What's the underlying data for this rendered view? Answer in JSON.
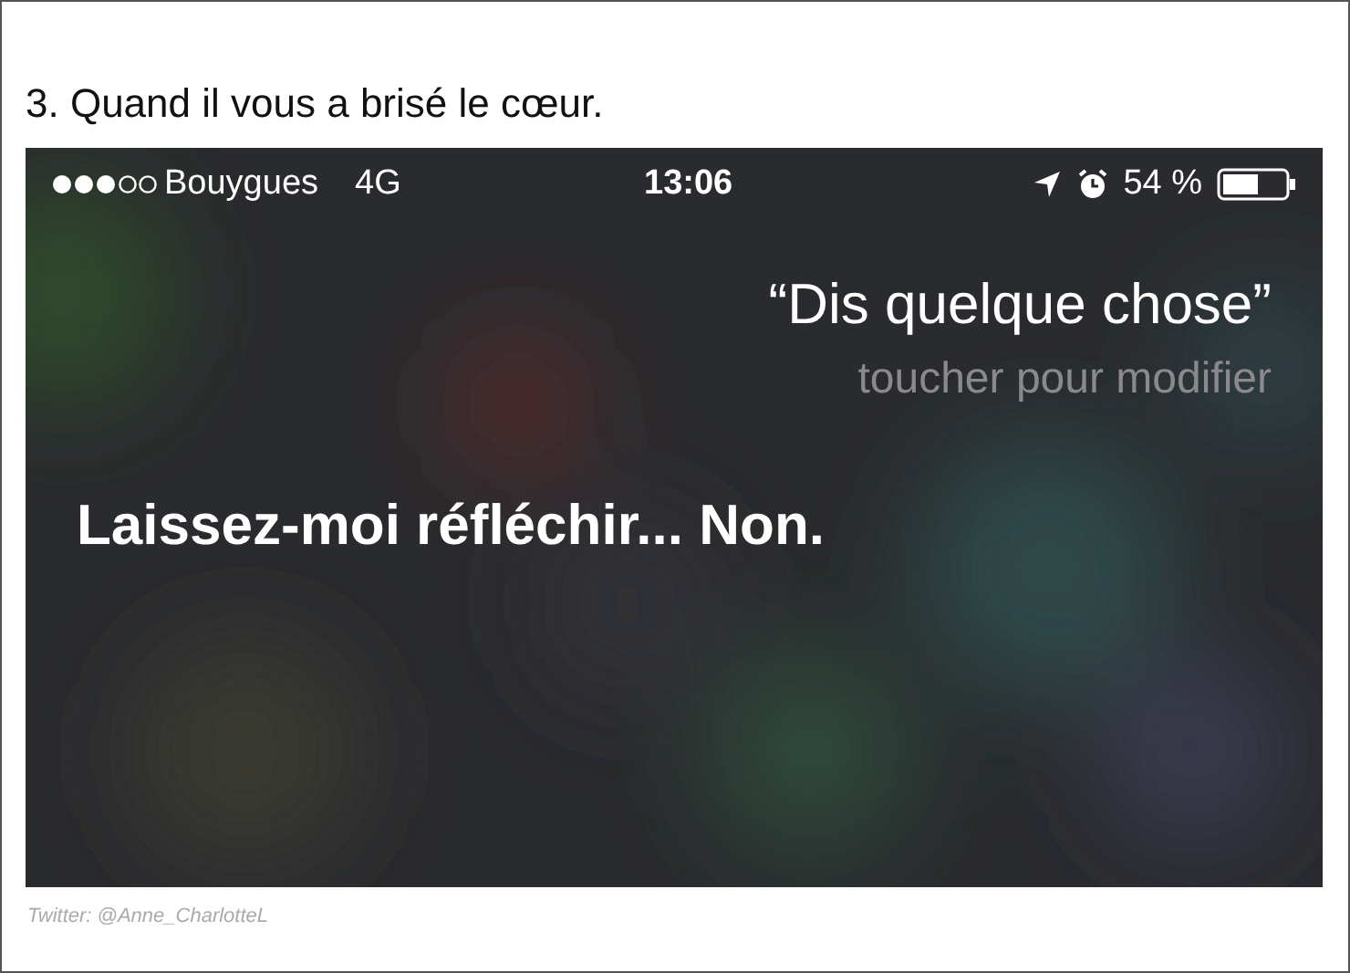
{
  "heading": "3. Quand il vous a brisé le cœur.",
  "phone": {
    "status_bar": {
      "carrier": "Bouygues",
      "network": "4G",
      "time": "13:06",
      "battery": "54 %"
    },
    "query": "“Dis quelque chose”",
    "hint": "toucher pour modifier",
    "answer": "Laissez-moi réfléchir... Non."
  },
  "caption": "Twitter: @Anne_CharlotteL"
}
